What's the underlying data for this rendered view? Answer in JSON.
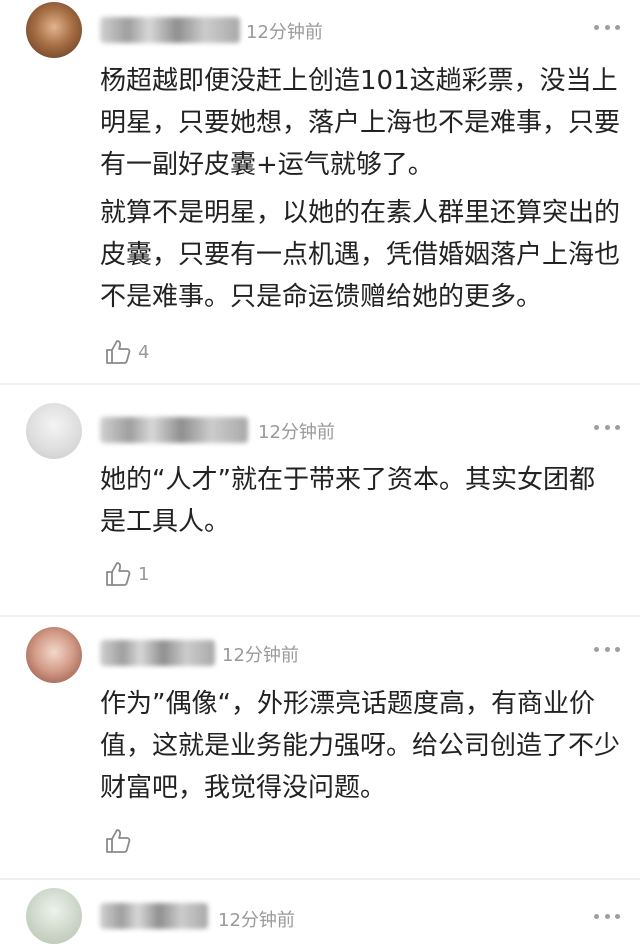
{
  "comments": [
    {
      "time": "12分钟前",
      "paragraphs": [
        "杨超越即便没赶上创造101这趟彩票，没当上明星，只要她想，落户上海也不是难事，只要有一副好皮囊+运气就够了。",
        "就算不是明星，以她的在素人群里还算突出的皮囊，只要有一点机遇，凭借婚姻落户上海也不是难事。只是命运馈赠给她的更多。"
      ],
      "likes": "4"
    },
    {
      "time": "12分钟前",
      "paragraphs": [
        "她的“人才”就在于带来了资本。其实女团都是工具人。"
      ],
      "likes": "1"
    },
    {
      "time": "12分钟前",
      "paragraphs": [
        "作为”偶像“，外形漂亮话题度高，有商业价值，这就是业务能力强呀。给公司创造了不少财富吧，我觉得没问题。"
      ],
      "likes": ""
    },
    {
      "time": "12分钟前",
      "paragraphs": [],
      "likes": ""
    }
  ],
  "icons": {
    "like": "thumbs-up-icon",
    "more": "more-dots-icon"
  },
  "colors": {
    "text": "#222222",
    "meta": "#9a9a9a",
    "divider": "#efefef"
  }
}
